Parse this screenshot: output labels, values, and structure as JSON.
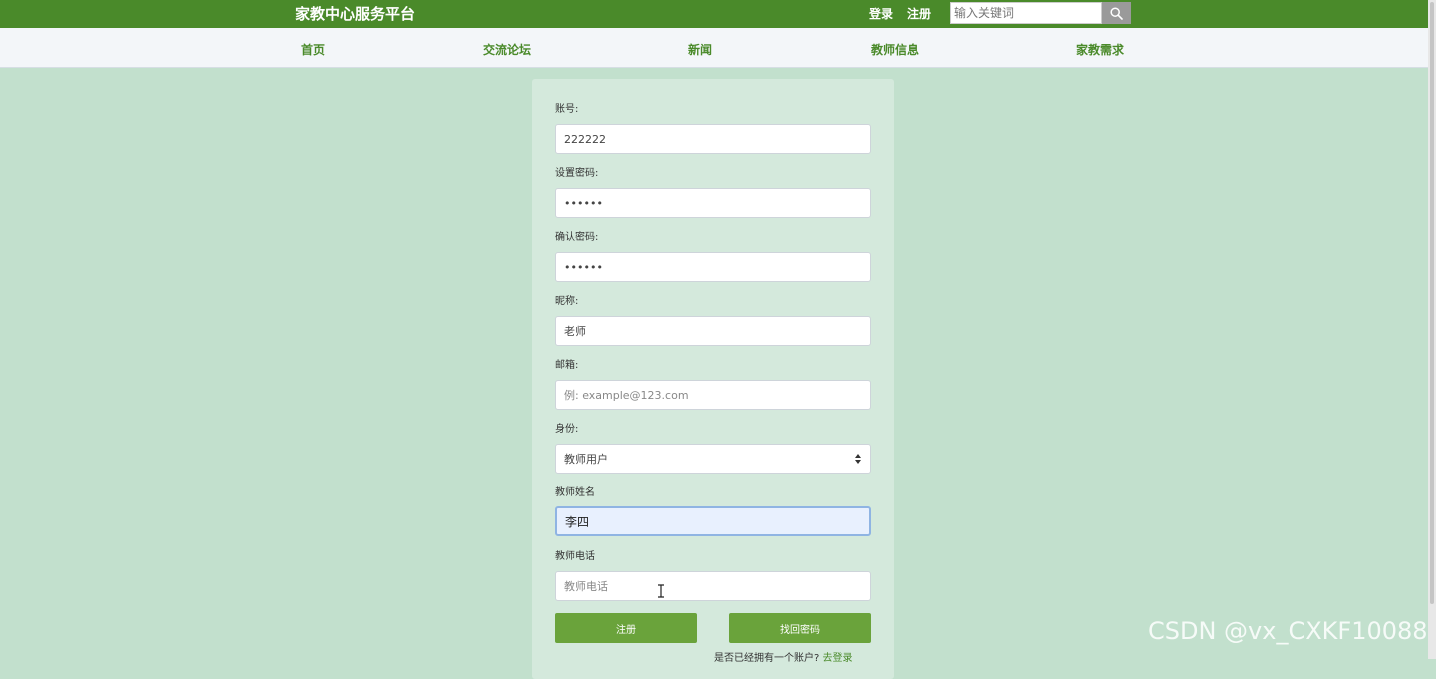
{
  "header": {
    "brand": "家教中心服务平台",
    "login_link": "登录",
    "register_link": "注册",
    "search_placeholder": "输入关键词",
    "search_icon": "search-icon"
  },
  "nav": {
    "items": [
      "首页",
      "交流论坛",
      "新闻",
      "教师信息",
      "家教需求"
    ]
  },
  "form": {
    "account_label": "账号:",
    "account_value": "222222",
    "password_label": "设置密码:",
    "password_value": "222222",
    "confirm_label": "确认密码:",
    "confirm_value": "222222",
    "nickname_label": "昵称:",
    "nickname_value": "老师",
    "email_label": "邮箱:",
    "email_placeholder": "例: example@123.com",
    "role_label": "身份:",
    "role_value": "教师用户",
    "teacher_name_label": "教师姓名",
    "teacher_name_value": "李四",
    "teacher_phone_label": "教师电话",
    "teacher_phone_placeholder": "教师电话",
    "register_button": "注册",
    "recover_button": "找回密码",
    "have_account_text": "是否已经拥有一个账户?",
    "go_login_link": "去登录"
  },
  "watermark": "CSDN @vx_CXKF10088",
  "colors": {
    "header_bg": "#4a8a2a",
    "page_bg": "#c2e0cd",
    "panel_bg": "#d4e9dc",
    "button_bg": "#6aa33b",
    "nav_text": "#4a8a2a",
    "focus_bg": "#e8f0fe"
  }
}
